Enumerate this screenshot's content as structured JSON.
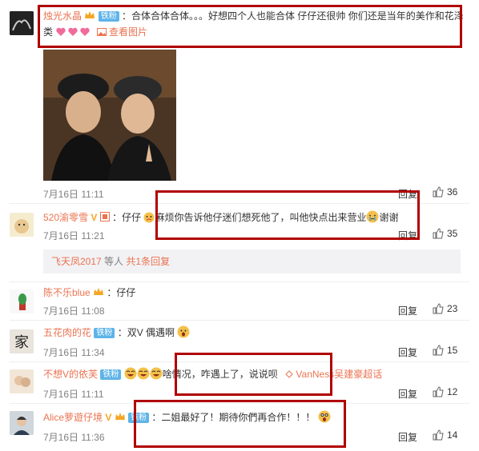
{
  "comments": [
    {
      "username": "烛光水晶",
      "fan_badge": "铁粉",
      "text": "：合体合体合体。。。好想四个人也能合体 仔仔还很帅 你们还是当年的美作和花泽类",
      "view_image": "查看图片",
      "time": "7月16日 11:11",
      "reply": "回复",
      "likes": "36"
    },
    {
      "username": "520渝零雪",
      "text_a": "：仔仔",
      "text_b": "麻烦你告诉他仔迷们想死他了，叫他快点出来营业",
      "text_c": "谢谢",
      "time": "7月16日 11:21",
      "reply": "回复",
      "likes": "35",
      "sub_user": "飞天凤2017",
      "sub_text": "等人",
      "sub_count": "共1条回复"
    },
    {
      "username": "陈不乐blue",
      "text": "：仔仔",
      "time": "7月16日 11:08",
      "reply": "回复",
      "likes": "23"
    },
    {
      "username": "五花肉的花",
      "fan_badge": "铁粉",
      "text": "：双V 偶遇啊",
      "time": "7月16日 11:34",
      "reply": "回复",
      "likes": "15"
    },
    {
      "username": "不想V的依芙",
      "fan_badge": "铁粉",
      "text": "啥情况，咋遇上了，说说呗",
      "mention": "VanNess吴建豪超话",
      "time": "7月16日 11:11",
      "reply": "回复",
      "likes": "12"
    },
    {
      "username": "Alice萝遊仔境",
      "fan_badge": "铁粉",
      "text": "：二姐最好了！期待你們再合作！！！",
      "time": "7月16日 11:36",
      "reply": "回复",
      "likes": "14"
    }
  ],
  "colors": {
    "username": "#eb7350",
    "fan_badge": "#5eb4e8",
    "highlight_box": "#b00000",
    "meta": "#808080"
  },
  "icons": [
    "like-icon",
    "vip-crown-icon",
    "heart-emoji-icon",
    "laugh-emoji-icon",
    "cry-emoji-icon",
    "surprised-emoji-icon"
  ]
}
